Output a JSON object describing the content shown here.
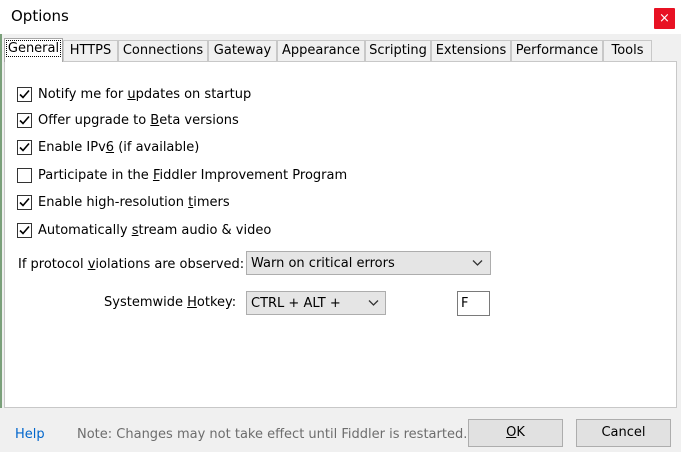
{
  "window": {
    "title": "Options",
    "close_glyph": "×"
  },
  "tabs": [
    {
      "label": "General",
      "active": true
    },
    {
      "label": "HTTPS"
    },
    {
      "label": "Connections"
    },
    {
      "label": "Gateway"
    },
    {
      "label": "Appearance"
    },
    {
      "label": "Scripting"
    },
    {
      "label": "Extensions"
    },
    {
      "label": "Performance"
    },
    {
      "label": "Tools"
    }
  ],
  "general": {
    "checkboxes": [
      {
        "pre": "Notify me for ",
        "key": "u",
        "post": "pdates on startup",
        "checked": true
      },
      {
        "pre": "Offer upgrade to ",
        "key": "B",
        "post": "eta versions",
        "checked": true
      },
      {
        "pre": "Enable IPv",
        "key": "6",
        "post": " (if available)",
        "checked": true
      },
      {
        "pre": "Participate in the ",
        "key": "F",
        "post": "iddler Improvement Program",
        "checked": false
      },
      {
        "pre": "Enable high-resolution ",
        "key": "t",
        "post": "imers",
        "checked": true
      },
      {
        "pre": "Automatically ",
        "key": "s",
        "post": "tream audio & video",
        "checked": true
      }
    ],
    "violations": {
      "label_pre": "If protocol ",
      "label_key": "v",
      "label_post": "iolations are observed:",
      "selected": "Warn on critical errors"
    },
    "hotkey": {
      "label_pre": "Systemwide ",
      "label_key": "H",
      "label_post": "otkey:",
      "modifier_selected": "CTRL + ALT +",
      "key_value": "F"
    }
  },
  "footer": {
    "help": "Help",
    "note": "Note: Changes may not take effect until Fiddler is restarted.",
    "ok_key": "O",
    "ok_rest": "K",
    "cancel": "Cancel"
  },
  "colors": {
    "accent": "#0066cc",
    "close": "#e81123"
  }
}
